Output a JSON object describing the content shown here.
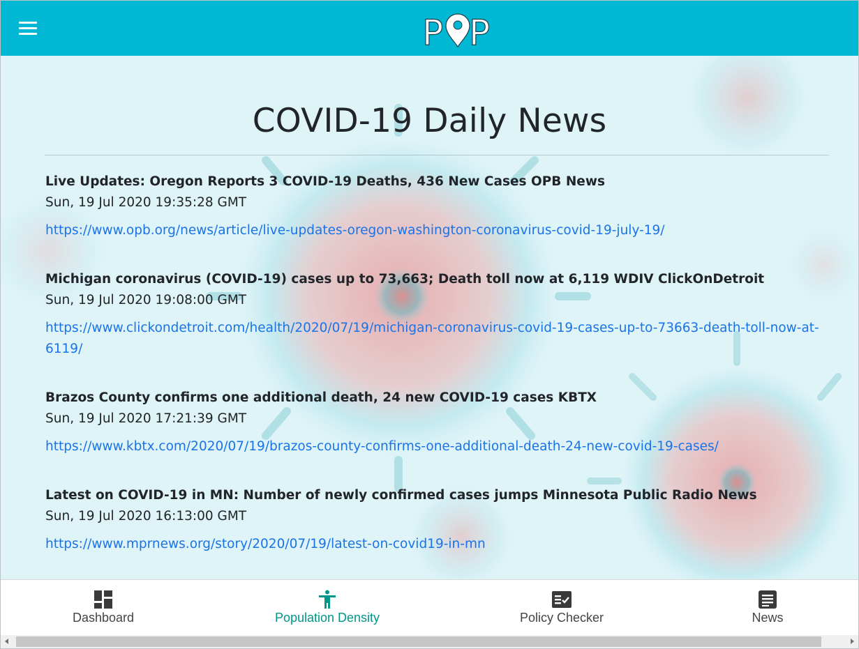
{
  "app": {
    "logo_text": "POP",
    "colors": {
      "header": "#00b8d4",
      "link": "#1a73e8",
      "active_tab": "#009688",
      "text": "#212529"
    }
  },
  "header": {
    "menu_icon": "hamburger-menu-icon"
  },
  "page": {
    "title": "COVID-19 Daily News",
    "articles": [
      {
        "headline": "Live Updates: Oregon Reports 3 COVID-19 Deaths, 436 New Cases OPB News",
        "date": "Sun, 19 Jul 2020 19:35:28 GMT",
        "url": "https://www.opb.org/news/article/live-updates-oregon-washington-coronavirus-covid-19-july-19/"
      },
      {
        "headline": "Michigan coronavirus (COVID-19) cases up to 73,663; Death toll now at 6,119 WDIV ClickOnDetroit",
        "date": "Sun, 19 Jul 2020 19:08:00 GMT",
        "url": "https://www.clickondetroit.com/health/2020/07/19/michigan-coronavirus-covid-19-cases-up-to-73663-death-toll-now-at-6119/"
      },
      {
        "headline": "Brazos County confirms one additional death, 24 new COVID-19 cases KBTX",
        "date": "Sun, 19 Jul 2020 17:21:39 GMT",
        "url": "https://www.kbtx.com/2020/07/19/brazos-county-confirms-one-additional-death-24-new-covid-19-cases/"
      },
      {
        "headline": "Latest on COVID-19 in MN: Number of newly confirmed cases jumps Minnesota Public Radio News",
        "date": "Sun, 19 Jul 2020 16:13:00 GMT",
        "url": "https://www.mprnews.org/story/2020/07/19/latest-on-covid19-in-mn"
      }
    ]
  },
  "bottom_nav": {
    "items": [
      {
        "label": "Dashboard",
        "icon": "dashboard-icon",
        "active": false
      },
      {
        "label": "Population Density",
        "icon": "accessibility-person-icon",
        "active": true
      },
      {
        "label": "Policy Checker",
        "icon": "checklist-icon",
        "active": false
      },
      {
        "label": "News",
        "icon": "article-icon",
        "active": false
      }
    ]
  }
}
